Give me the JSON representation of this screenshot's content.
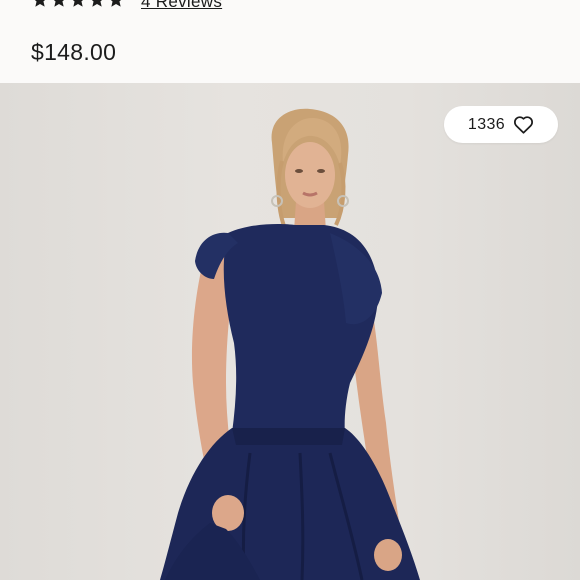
{
  "product": {
    "rating_stars": 5,
    "reviews_label": "4 Reviews",
    "price": "$148.00"
  },
  "photo": {
    "alt_subject": "model wearing navy drop-waist dress"
  },
  "likes": {
    "count": "1336",
    "icon": "heart-outline-icon"
  },
  "colors": {
    "text": "#1c1c1c",
    "dress": "#1f2a5c",
    "background": "#e4e1dd"
  }
}
